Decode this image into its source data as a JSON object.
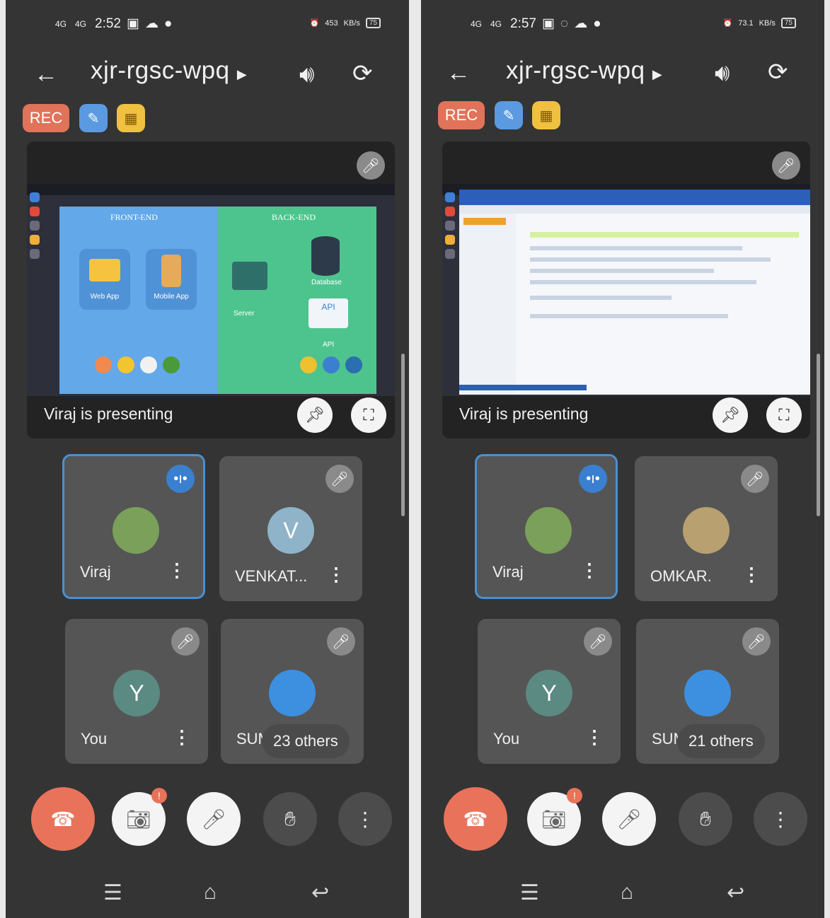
{
  "common": {
    "meeting_code": "xjr-rgsc-wpq",
    "rec_label": "REC",
    "presenting_text": "Viraj is presenting",
    "network_1": "4G",
    "network_2": "4G",
    "battery": "75",
    "speed_left": "453",
    "speed_right": "73.1",
    "speed_unit": "KB/s"
  },
  "left": {
    "time": "2:52",
    "slide": {
      "front_end": "FRONT-END",
      "back_end": "BACK-END",
      "web_app": "Web App",
      "mobile_app": "Mobile App",
      "server": "Server",
      "database": "Database",
      "api_box": "API",
      "api_label": "API"
    },
    "tiles": [
      {
        "name": "Viraj",
        "initial": "",
        "color": "#7aa05a",
        "active": true
      },
      {
        "name": "VENKAT...",
        "initial": "V",
        "color": "#8fb3c9",
        "active": false
      },
      {
        "name": "You",
        "initial": "Y",
        "color": "#5a8a82",
        "active": false
      },
      {
        "name": "SUM",
        "initial": "",
        "color": "#3d8fe0",
        "active": false
      }
    ],
    "others": "23 others"
  },
  "right": {
    "time": "2:57",
    "tiles": [
      {
        "name": "Viraj",
        "initial": "",
        "color": "#7aa05a",
        "active": true
      },
      {
        "name": "OMKAR.",
        "initial": "",
        "color": "#b8a070",
        "active": false
      },
      {
        "name": "You",
        "initial": "Y",
        "color": "#5a8a82",
        "active": false
      },
      {
        "name": "SUM",
        "initial": "",
        "color": "#3d8fe0",
        "active": false
      }
    ],
    "others": "21 others"
  },
  "controls": {
    "notification_count": "!"
  },
  "icons": [
    "back-arrow-icon",
    "play-arrow-icon",
    "speaker-icon",
    "switch-camera-icon",
    "caption-icon",
    "no-video-icon",
    "mic-off-icon",
    "unpin-icon",
    "fullscreen-icon",
    "speaking-icon",
    "more-icon",
    "end-call-icon",
    "camera-off-icon",
    "hand-raise-icon",
    "menu-icon",
    "home-icon",
    "back-nav-icon"
  ]
}
